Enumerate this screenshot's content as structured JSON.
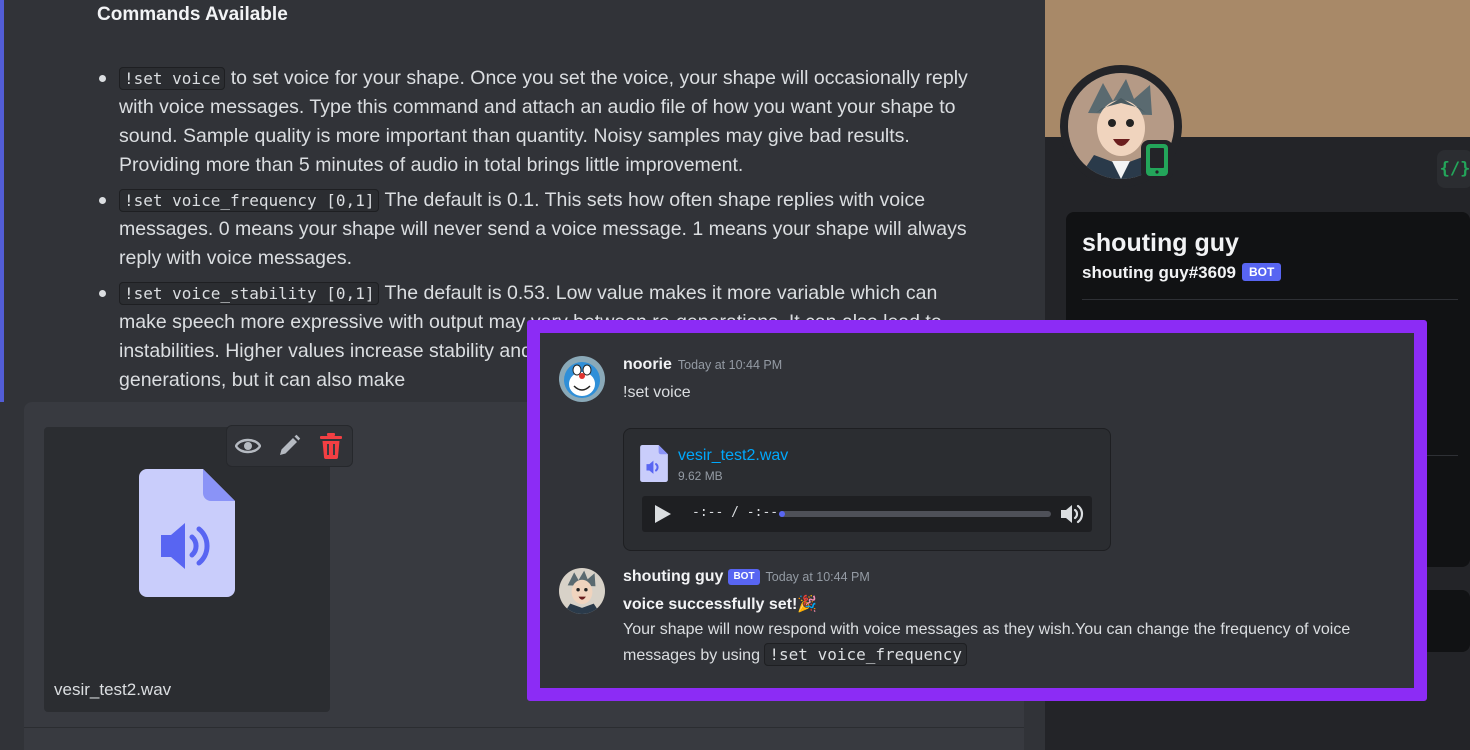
{
  "commands": {
    "title": "Commands Available",
    "items": [
      {
        "code": "!set voice",
        "text": " to set voice for your shape. Once you set the voice, your shape will occasionally reply with voice messages. Type this command and attach an audio file of how you want your shape to sound. Sample quality is more important than quantity. Noisy samples may give bad results. Providing more than 5 minutes of audio in total brings little improvement."
      },
      {
        "code": "!set voice_frequency [0,1]",
        "text": " The default is 0.1. This sets how often shape replies with voice messages. 0 means your shape will never send a voice message. 1 means your shape will always reply with voice messages."
      },
      {
        "code": "!set voice_stability [0,1]",
        "text": " The default is 0.53. Low value makes it more variable which can make speech more expressive with output may vary between re-generations. It can also lead to instabilities. Higher values increase stability and produce a more consistent voice between re-generations, but it can also make"
      }
    ]
  },
  "upload": {
    "filename": "vesir_test2.wav"
  },
  "profile": {
    "display_name": "shouting guy",
    "tag": "shouting guy#3609",
    "bot_label": "BOT",
    "dev_badge": "{/}"
  },
  "messages": [
    {
      "username": "noorie",
      "timestamp": "Today at 10:44 PM",
      "text": "!set voice",
      "attachment": {
        "filename": "vesir_test2.wav",
        "size": "9.62 MB",
        "time": "-:-- / -:--",
        "progress": 0.0
      }
    },
    {
      "username": "shouting guy",
      "bot_label": "BOT",
      "timestamp": "Today at 10:44 PM",
      "title": "voice successfully set!",
      "emoji": "🎉",
      "text": "Your shape will now respond with voice messages as they wish.You can change the frequency of voice messages by using ",
      "code": "!set voice_frequency"
    }
  ],
  "colors": {
    "accent": "#5865f2",
    "highlight": "#8c2cf5",
    "link": "#00a8fc",
    "online_mobile": "#23a55a",
    "delete": "#f23f43"
  }
}
